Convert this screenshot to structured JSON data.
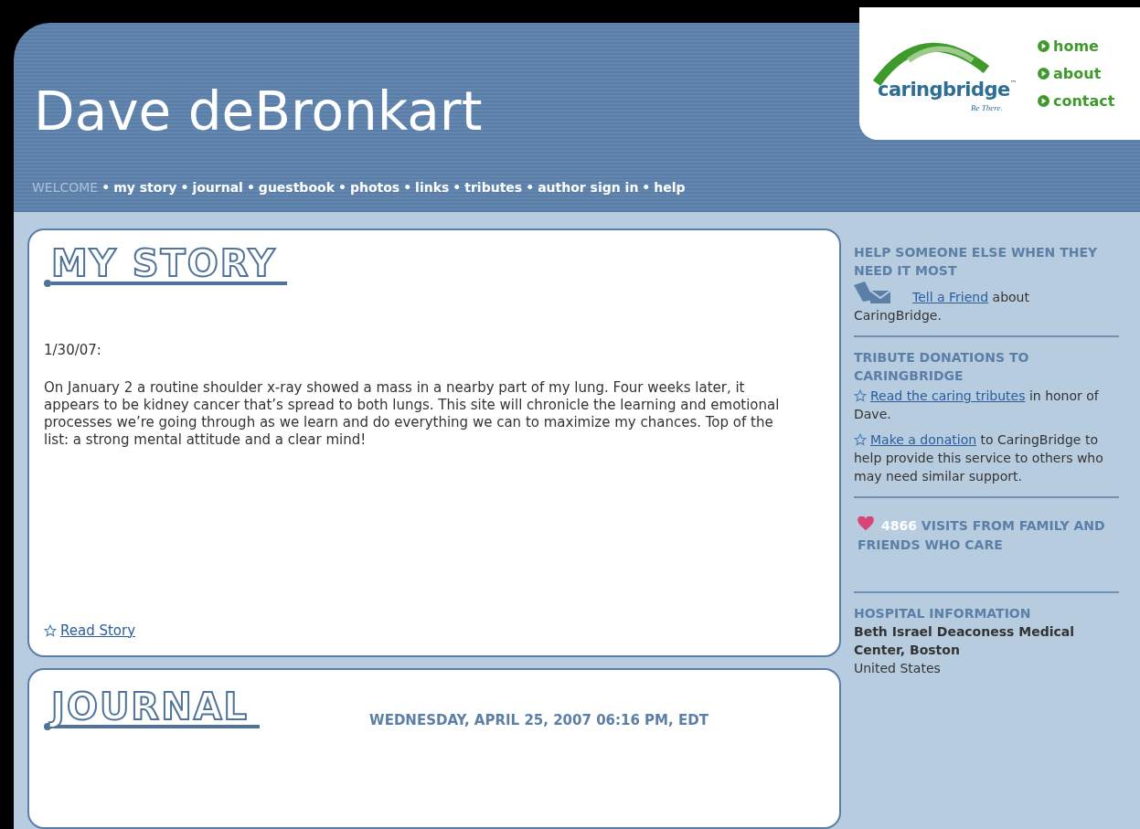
{
  "header": {
    "title": "Dave deBronkart",
    "nav": {
      "separator": "•",
      "items": [
        {
          "label": "WELCOME",
          "selected": true
        },
        {
          "label": "my story",
          "selected": false
        },
        {
          "label": "journal",
          "selected": false
        },
        {
          "label": "guestbook",
          "selected": false
        },
        {
          "label": "photos",
          "selected": false
        },
        {
          "label": "links",
          "selected": false
        },
        {
          "label": "tributes",
          "selected": false
        },
        {
          "label": "author sign in",
          "selected": false
        },
        {
          "label": "help",
          "selected": false
        }
      ]
    }
  },
  "logo": {
    "name": "caringbridge",
    "mark": "™",
    "tagline": "Be There.",
    "links": [
      "home",
      "about",
      "contact"
    ]
  },
  "story": {
    "heading": "MY STORY",
    "date": "1/30/07:",
    "body": "On January 2 a routine shoulder x-ray showed a mass in a nearby part of my lung. Four weeks later, it appears to be kidney cancer that’s spread to both lungs. This site will chronicle the learning and emotional processes we’re going through as we learn and do everything we can to maximize my chances. Top of the list: a strong mental attitude and a clear mind!",
    "link": "Read Story"
  },
  "journal": {
    "heading": "JOURNAL",
    "date": "WEDNESDAY, APRIL 25, 2007 06:16 PM, EDT"
  },
  "sidebar": [
    {
      "heading": "HELP SOMEONE ELSE WHEN THEY NEED IT MOST",
      "paragraphs": [
        {
          "kind": "envelope",
          "link": "Tell a Friend",
          "after": " about CaringBridge."
        }
      ]
    },
    {
      "heading": "TRIBUTE DONATIONS TO CARINGBRIDGE",
      "paragraphs": [
        {
          "kind": "star",
          "link": "Read the caring tributes",
          "after": " in honor of Dave."
        },
        {
          "kind": "star",
          "link": "Make a donation",
          "after": " to CaringBridge to help provide this service to others who may need similar support."
        }
      ]
    },
    {
      "count": "4866",
      "heading": "VISITS FROM FAMILY AND FRIENDS WHO CARE"
    },
    {
      "heading": "HOSPITAL INFORMATION",
      "name": "Beth Israel Deaconess Medical Center, Boston",
      "country": "United States"
    }
  ]
}
